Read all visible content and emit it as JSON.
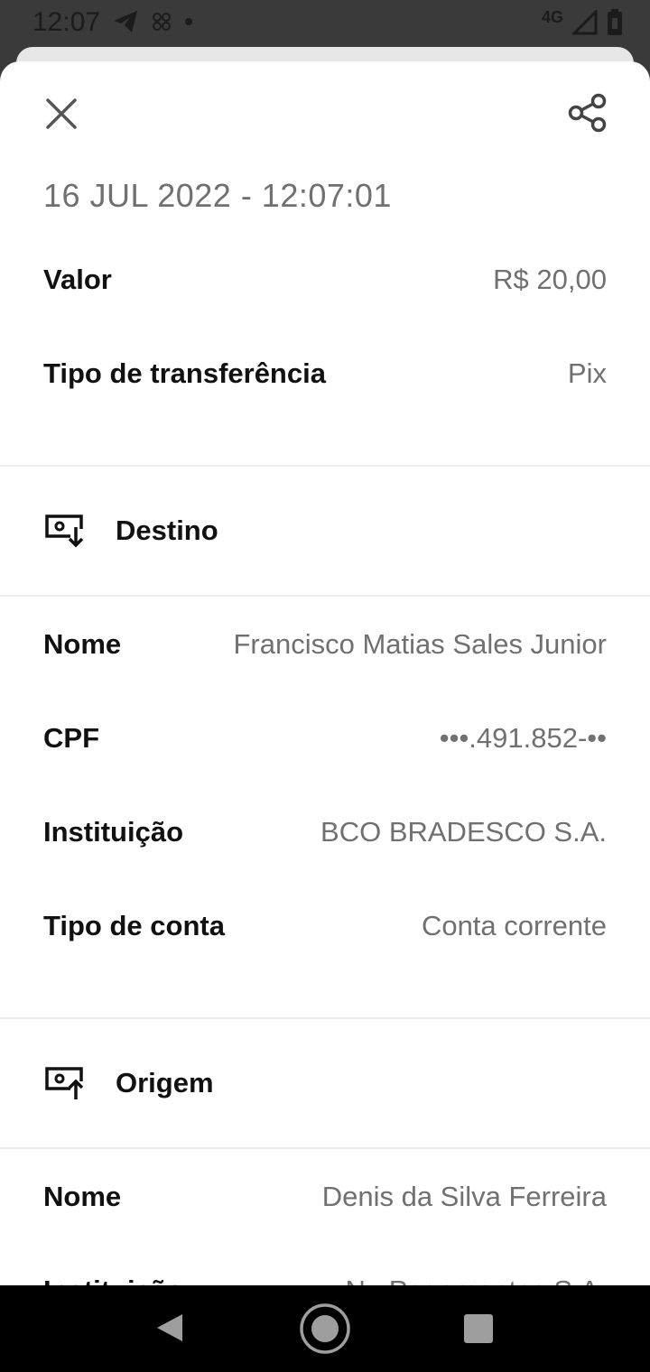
{
  "status_bar": {
    "time": "12:07",
    "network": "4G",
    "icons": [
      "telegram-icon",
      "app-notification-icon",
      "dot-icon",
      "signal-icon",
      "battery-icon"
    ]
  },
  "header": {
    "close_icon": "close-icon",
    "share_icon": "share-icon"
  },
  "transaction": {
    "datetime": "16 JUL 2022 - 12:07:01",
    "amount_label": "Valor",
    "amount_value": "R$ 20,00",
    "type_label": "Tipo de transferência",
    "type_value": "Pix"
  },
  "destination": {
    "title": "Destino",
    "icon": "money-in-icon",
    "name_label": "Nome",
    "name_value": "Francisco Matias Sales Junior",
    "cpf_label": "CPF",
    "cpf_value": "•••.491.852-••",
    "institution_label": "Instituição",
    "institution_value": "BCO BRADESCO S.A.",
    "account_type_label": "Tipo de conta",
    "account_type_value": "Conta corrente"
  },
  "origin": {
    "title": "Origem",
    "icon": "money-out-icon",
    "name_label": "Nome",
    "name_value": "Denis da Silva Ferreira",
    "institution_label": "Instituição",
    "institution_value": "Nu Pagamentos S.A."
  },
  "nav_bar": {
    "back_icon": "back-triangle-icon",
    "home_icon": "home-circle-icon",
    "recents_icon": "recents-square-icon"
  },
  "colors": {
    "label": "#111111",
    "value": "#707070",
    "status_bar_bg": "#3a3a3a"
  }
}
